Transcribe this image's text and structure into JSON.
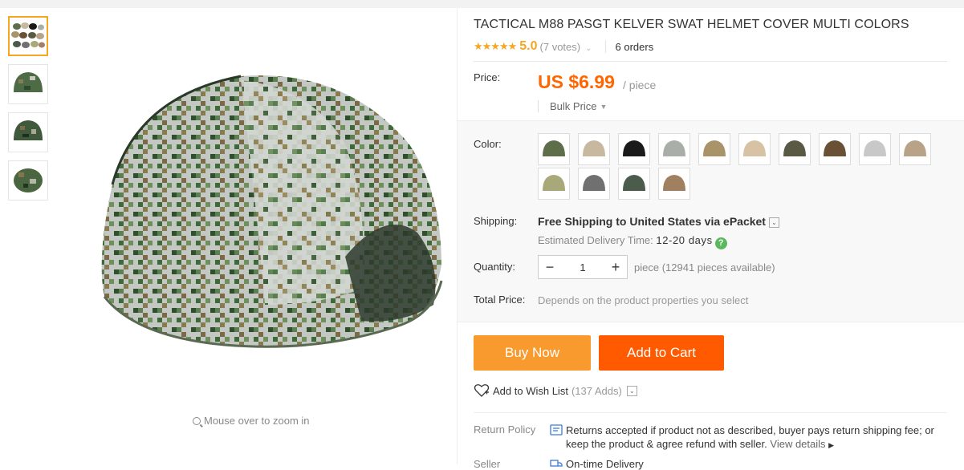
{
  "product": {
    "title": "TACTICAL M88 PASGT KELVER SWAT HELMET COVER MULTI COLORS",
    "rating": "5.0",
    "votes": "(7 votes)",
    "orders": "6 orders"
  },
  "price": {
    "label": "Price:",
    "value": "US $6.99",
    "unit": "/ piece",
    "bulk": "Bulk Price"
  },
  "color": {
    "label": "Color:",
    "swatches": [
      "#5e6e4a",
      "#c8b8a0",
      "#1a1a1a",
      "#a9aea8",
      "#a89468",
      "#d8c2a4",
      "#5a5a44",
      "#6a5034",
      "#c8c8c8",
      "#b8a288",
      "#a8a878",
      "#707070",
      "#4c5c4c",
      "#a08060"
    ]
  },
  "shipping": {
    "label": "Shipping:",
    "method": "Free Shipping to United States via ePacket",
    "eta_label": "Estimated Delivery Time:",
    "eta_value": "12-20 days",
    "help": "?"
  },
  "quantity": {
    "label": "Quantity:",
    "value": "1",
    "minus": "−",
    "plus": "+",
    "available": "piece (12941 pieces available)"
  },
  "total": {
    "label": "Total Price:",
    "value": "Depends on the product properties you select"
  },
  "actions": {
    "buy_now": "Buy Now",
    "add_to_cart": "Add to Cart",
    "wish_label": "Add to Wish List",
    "wish_count": "(137 Adds)"
  },
  "policy": {
    "return_label": "Return Policy",
    "return_text": "Returns accepted if product not as described, buyer pays return shipping fee; or keep the product & agree refund with seller.",
    "view_details": "View details",
    "seller_label": "Seller",
    "ontime": "On-time Delivery"
  },
  "gallery": {
    "zoom_hint": "Mouse over to zoom in"
  }
}
